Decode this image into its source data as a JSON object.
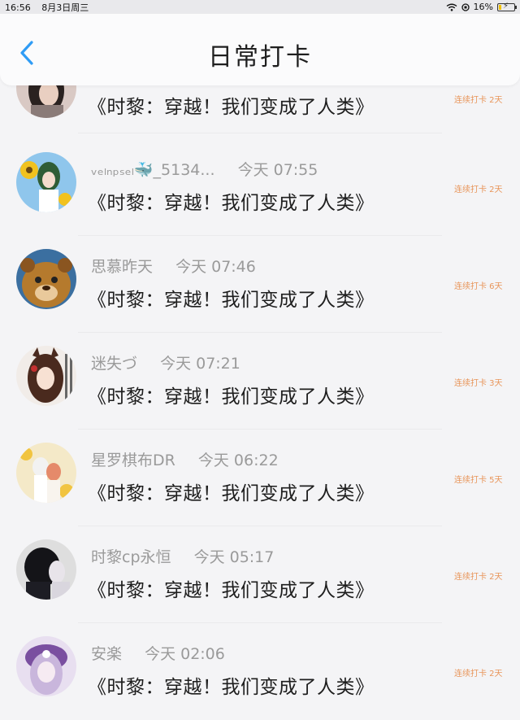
{
  "status_bar": {
    "time": "16:56",
    "date": "8月3日周三",
    "battery": "16%",
    "battery_level": 0.16
  },
  "header": {
    "title": "日常打卡",
    "back_icon": "chevron-left-icon",
    "accent": "#2f9cf5"
  },
  "checkins": [
    {
      "username": "",
      "time": "",
      "message": "《时黎：穿越！我们变成了人类》",
      "streak": "连续打卡 2天"
    },
    {
      "username": "ᵥₑₗₙₚₛₑₗ🐳_5134...",
      "time": "今天 07:55",
      "message": "《时黎：穿越！我们变成了人类》",
      "streak": "连续打卡 2天"
    },
    {
      "username": "思慕昨天",
      "time": "今天 07:46",
      "message": "《时黎：穿越！我们变成了人类》",
      "streak": "连续打卡 6天"
    },
    {
      "username": "迷失づ",
      "time": "今天 07:21",
      "message": "《时黎：穿越！我们变成了人类》",
      "streak": "连续打卡 3天"
    },
    {
      "username": "星罗棋布DR",
      "time": "今天 06:22",
      "message": "《时黎：穿越！我们变成了人类》",
      "streak": "连续打卡 5天"
    },
    {
      "username": "时黎cp永恒",
      "time": "今天 05:17",
      "message": "《时黎：穿越！我们变成了人类》",
      "streak": "连续打卡 2天"
    },
    {
      "username": "安楽",
      "time": "今天 02:06",
      "message": "《时黎：穿越！我们变成了人类》",
      "streak": "连续打卡 2天"
    }
  ],
  "colors": {
    "streak": "#e8955a",
    "username": "#9a9a9a",
    "background": "#f4f4f6"
  }
}
